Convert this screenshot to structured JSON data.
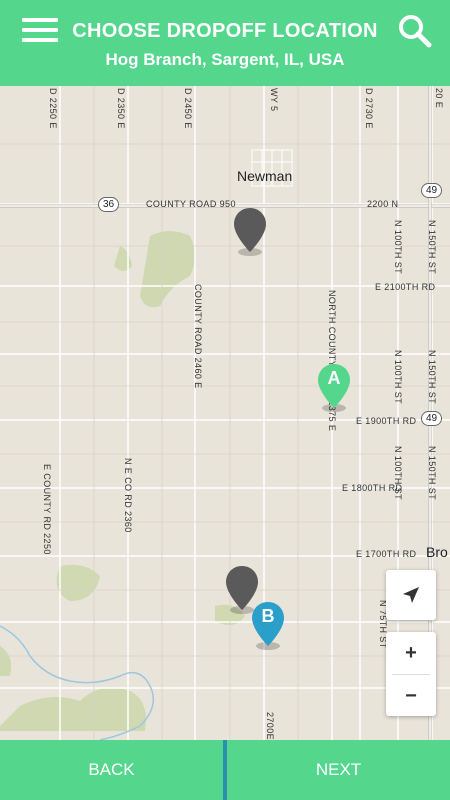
{
  "header": {
    "title": "CHOOSE DROPOFF LOCATION",
    "subtitle": "Hog Branch, Sargent, IL, USA"
  },
  "map": {
    "town": "Newman",
    "roads": {
      "d2250": "D 2250 E",
      "d2350": "D 2350 E",
      "d2450": "D 2450 E",
      "wy5": "WY 5",
      "d2730": "D 2730 E",
      "d20e": "20 E",
      "county950": "COUNTY ROAD 950",
      "n2200": "2200 N",
      "n100th_a": "N 100TH ST",
      "n150th_a": "N 150TH ST",
      "county2460": "COUNTY ROAD 2460 E",
      "e2100th": "E 2100TH RD",
      "northcounty": "NORTH COUNTY ROAD 2375 E",
      "n100th_b": "N 100TH ST",
      "n150th_b": "N 150TH ST",
      "e1900th": "E 1900TH RD",
      "ecounty2250": "E COUNTY RD 2250",
      "neco2360": "N E CO RD 2360",
      "n100th_c": "N 100TH ST",
      "n150th_c": "N 150TH ST",
      "e1800th": "E 1800TH RD",
      "e1700th": "E 1700TH RD",
      "bro": "Bro",
      "n75th": "N 75TH ST",
      "r2700": "2700E"
    },
    "shields": {
      "us36": "36",
      "il49a": "49",
      "il49b": "49"
    },
    "pins": {
      "a_letter": "A",
      "b_letter": "B"
    },
    "colors": {
      "pin_a": "#55d68d",
      "pin_b": "#2a9fc9",
      "pin_gray": "#5a5a5a"
    }
  },
  "controls": {
    "zoom_in": "+",
    "zoom_out": "−"
  },
  "footer": {
    "back_label": "BACK",
    "next_label": "NEXT"
  },
  "colors": {
    "accent": "#55d68d",
    "divider": "#2a8fb0",
    "map_bg": "#e9e4d9"
  }
}
